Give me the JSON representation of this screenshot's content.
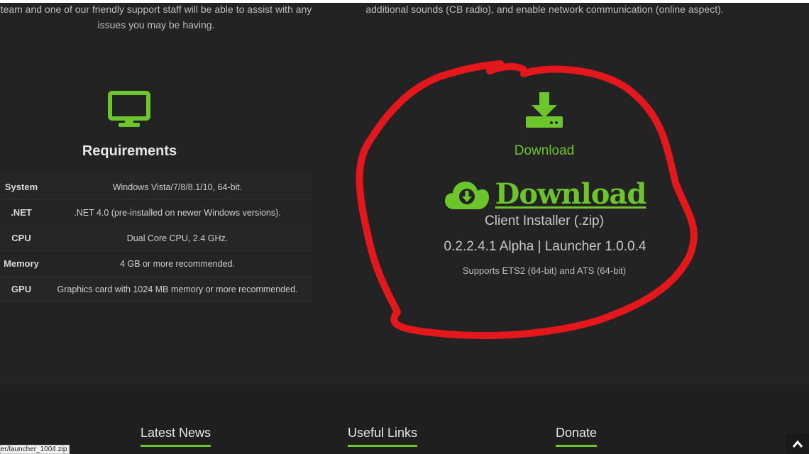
{
  "intro": {
    "left_text": "team and one of our friendly support staff will be able to assist with any issues you may be having.",
    "right_text": "additional sounds (CB radio), and enable network communication (online aspect)."
  },
  "requirements": {
    "icon": "monitor-icon",
    "title": "Requirements",
    "rows": [
      {
        "key": "System",
        "value": "Windows Vista/7/8/8.1/10, 64-bit."
      },
      {
        "key": ".NET",
        "value": ".NET 4.0 (pre-installed on newer Windows versions)."
      },
      {
        "key": "CPU",
        "value": "Dual Core CPU, 2.4 GHz."
      },
      {
        "key": "Memory",
        "value": "4 GB or more recommended."
      },
      {
        "key": "GPU",
        "value": "Graphics card with 1024 MB memory or more recommended."
      }
    ]
  },
  "download": {
    "icon": "download-tray-icon",
    "label": "Download",
    "link_icon": "cloud-download-icon",
    "link_text": "Download",
    "subtitle": "Client Installer (.zip)",
    "version": "0.2.2.4.1 Alpha | Launcher 1.0.0.4",
    "supports": "Supports ETS2 (64-bit) and ATS (64-bit)"
  },
  "footer": {
    "headings": [
      "Latest News",
      "Useful Links",
      "Donate"
    ]
  },
  "status_bar": {
    "url": "er/launcher_1004.zip"
  },
  "colors": {
    "accent": "#6cc52b",
    "background": "#232323",
    "annotation": "#e4181c"
  }
}
